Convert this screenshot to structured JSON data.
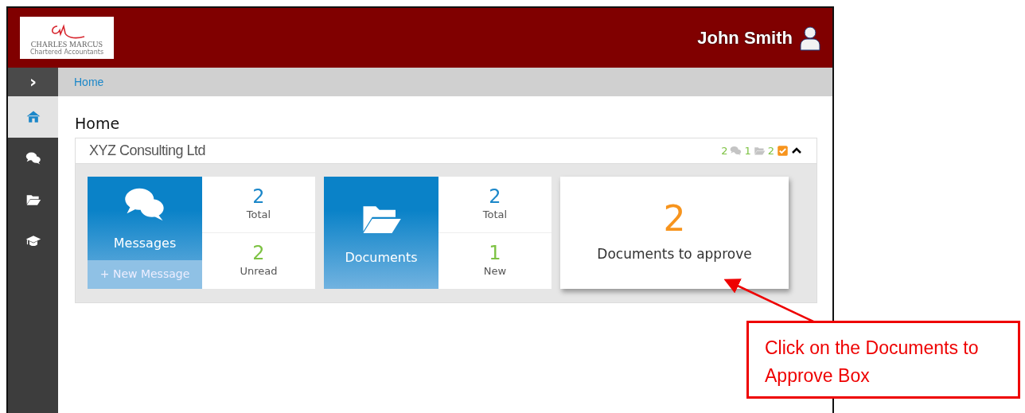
{
  "header": {
    "logo": {
      "name": "CHARLES MARCUS",
      "tagline": "Chartered Accountants"
    },
    "user": "John Smith"
  },
  "sidebar": {
    "toggle": "›",
    "items": [
      {
        "kind": "home",
        "selected": true
      },
      {
        "kind": "messages",
        "selected": false
      },
      {
        "kind": "documents",
        "selected": false
      },
      {
        "kind": "learning",
        "selected": false
      }
    ]
  },
  "breadcrumb": [
    "Home"
  ],
  "page_title": "Home",
  "panel": {
    "title": "XYZ Consulting Ltd",
    "expanded": true,
    "counters": [
      {
        "value": "2",
        "kind": "messages"
      },
      {
        "value": "1",
        "kind": "documents"
      },
      {
        "value": "2",
        "kind": "approve"
      }
    ],
    "tiles": [
      {
        "kind": "split",
        "label": "Messages",
        "action": "+ New Message",
        "stats": [
          {
            "value": "2",
            "label": "Total",
            "color": "#1b87c9"
          },
          {
            "value": "2",
            "label": "Unread",
            "color": "#7dc243"
          }
        ]
      },
      {
        "kind": "split",
        "label": "Documents",
        "stats": [
          {
            "value": "2",
            "label": "Total",
            "color": "#1b87c9"
          },
          {
            "value": "1",
            "label": "New",
            "color": "#7dc243"
          }
        ]
      },
      {
        "kind": "single",
        "value": "2",
        "label": "Documents to approve"
      }
    ]
  },
  "callout": {
    "text": "Click on the Documents to Approve Box"
  }
}
